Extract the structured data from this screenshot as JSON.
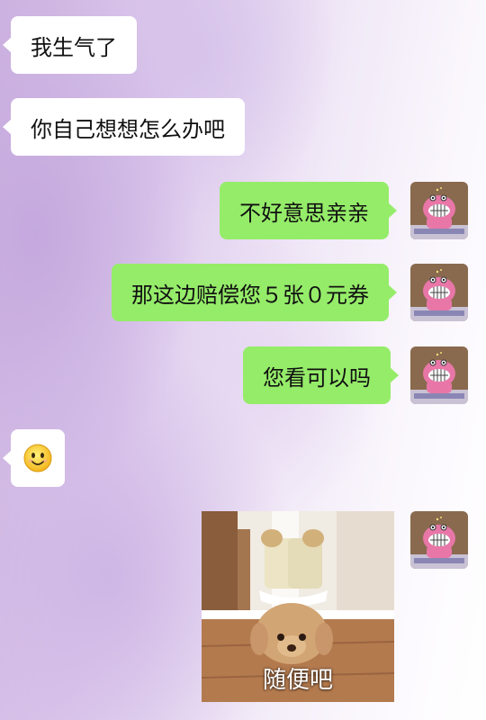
{
  "messages": [
    {
      "side": "left",
      "text": "我生气了"
    },
    {
      "side": "left",
      "text": "你自己想想怎么办吧"
    },
    {
      "side": "right",
      "text": "不好意思亲亲"
    },
    {
      "side": "right",
      "text": "那这边赔偿您５张０元券"
    },
    {
      "side": "right",
      "text": "您看可以吗"
    },
    {
      "side": "left",
      "emoji": "smiling-face-emoji"
    },
    {
      "side": "right",
      "sticker": "upside-down-plush-bear",
      "caption": "随便吧"
    }
  ],
  "avatar": {
    "icon": "pink-cartoon-avatar",
    "colors": {
      "background": "#8a6a4e",
      "figure": "#e877a8"
    }
  },
  "colors": {
    "right_bubble": "#95ec69",
    "left_bubble": "#ffffff",
    "background_accent": "#cdb3e0"
  }
}
